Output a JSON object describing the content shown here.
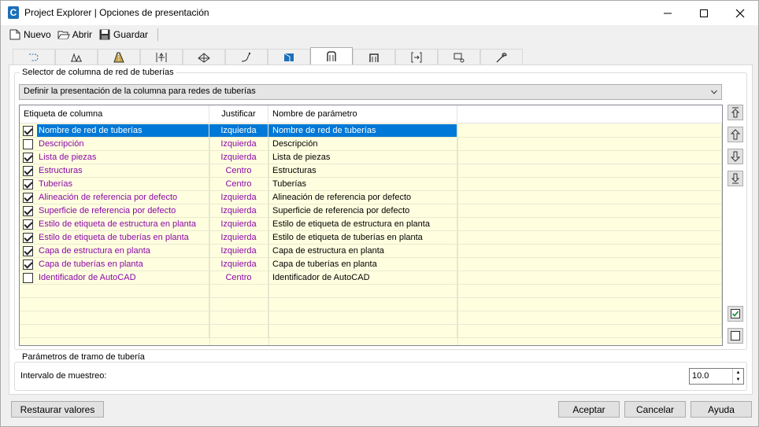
{
  "window": {
    "title": "Project Explorer | Opciones de presentación",
    "app_icon_letter": "C"
  },
  "toolbar": {
    "new_label": "Nuevo",
    "open_label": "Abrir",
    "save_label": "Guardar"
  },
  "tabs": [
    {
      "icon": "alignment-icon"
    },
    {
      "icon": "profile-icon"
    },
    {
      "icon": "corridor-icon"
    },
    {
      "icon": "sample-lines-icon"
    },
    {
      "icon": "surface-icon"
    },
    {
      "icon": "feature-line-icon"
    },
    {
      "icon": "parcel-icon"
    },
    {
      "icon": "pipe-network-icon",
      "active": true
    },
    {
      "icon": "pressure-network-icon"
    },
    {
      "icon": "section-icon"
    },
    {
      "icon": "point-icon"
    },
    {
      "icon": "settings-wrench-icon"
    }
  ],
  "selector": {
    "group_label": "Selector de columna de red de tuberías",
    "combo_value": "Definir la presentación de la columna para redes de tuberías"
  },
  "table": {
    "headers": [
      "Etiqueta de columna",
      "Justificar",
      "Nombre de parámetro"
    ],
    "rows": [
      {
        "checked": true,
        "label": "Nombre de red de tuberías",
        "justify": "Izquierda",
        "param": "Nombre de red de tuberías",
        "selected": true
      },
      {
        "checked": false,
        "label": "Descripción",
        "justify": "Izquierda",
        "param": "Descripción"
      },
      {
        "checked": true,
        "label": "Lista de piezas",
        "justify": "Izquierda",
        "param": "Lista de piezas"
      },
      {
        "checked": true,
        "label": "Estructuras",
        "justify": "Centro",
        "param": "Estructuras"
      },
      {
        "checked": true,
        "label": "Tuberías",
        "justify": "Centro",
        "param": "Tuberías"
      },
      {
        "checked": true,
        "label": "Alineación de referencia por defecto",
        "justify": "Izquierda",
        "param": "Alineación de referencia por defecto"
      },
      {
        "checked": true,
        "label": "Superficie de referencia por defecto",
        "justify": "Izquierda",
        "param": "Superficie de referencia por defecto"
      },
      {
        "checked": true,
        "label": "Estilo de etiqueta de estructura en planta",
        "justify": "Izquierda",
        "param": "Estilo de etiqueta de estructura en planta"
      },
      {
        "checked": true,
        "label": "Estilo de etiqueta de tuberías en planta",
        "justify": "Izquierda",
        "param": "Estilo de etiqueta de tuberías en planta"
      },
      {
        "checked": true,
        "label": "Capa de estructura en planta",
        "justify": "Izquierda",
        "param": "Capa de estructura en planta"
      },
      {
        "checked": true,
        "label": "Capa de tuberías en planta",
        "justify": "Izquierda",
        "param": "Capa de tuberías en planta"
      },
      {
        "checked": false,
        "label": "Identificador de AutoCAD",
        "justify": "Centro",
        "param": "Identificador de AutoCAD"
      }
    ]
  },
  "side_buttons": [
    "move-to-top-icon",
    "move-up-icon",
    "move-down-icon",
    "move-to-bottom-icon",
    "check-all-icon",
    "uncheck-all-icon"
  ],
  "sampling": {
    "group_label": "Parámetros de tramo de tubería",
    "interval_label": "Intervalo de muestreo:",
    "interval_value": "10.0"
  },
  "footer": {
    "restore_label": "Restaurar valores",
    "accept_label": "Aceptar",
    "cancel_label": "Cancelar",
    "help_label": "Ayuda"
  },
  "colors": {
    "accent": "#0078d7",
    "purple_text": "#8b08a8",
    "grid_background": "#ffffe0"
  }
}
